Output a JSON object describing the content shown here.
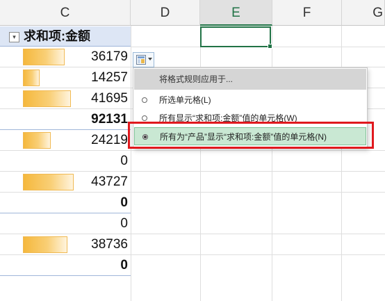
{
  "columns": [
    "C",
    "D",
    "E",
    "F",
    "G"
  ],
  "active_column": "E",
  "pivot_field_label": "求和项:金额",
  "rows": [
    {
      "value": "36179",
      "bold": false,
      "bar": 0.393
    },
    {
      "value": "14257",
      "bold": false,
      "bar": 0.155
    },
    {
      "value": "41695",
      "bold": false,
      "bar": 0.453
    },
    {
      "value": "92131",
      "bold": true,
      "bar": 0
    },
    {
      "value": "24219",
      "bold": false,
      "bar": 0.263
    },
    {
      "value": "0",
      "bold": false,
      "bar": 0
    },
    {
      "value": "43727",
      "bold": false,
      "bar": 0.475
    },
    {
      "value": "0",
      "bold": true,
      "bar": 0
    },
    {
      "value": "0",
      "bold": false,
      "bar": 0
    },
    {
      "value": "38736",
      "bold": false,
      "bar": 0.42
    },
    {
      "value": "0",
      "bold": true,
      "bar": 0
    }
  ],
  "menu": {
    "title": "将格式规则应用于...",
    "options": [
      {
        "label": "所选单元格(L)",
        "selected": false
      },
      {
        "label": "所有显示“求和项:金额”值的单元格(W)",
        "selected": false
      },
      {
        "label": "所有为“产品”显示“求和项:金额”值的单元格(N)",
        "selected": true
      }
    ]
  },
  "colors": {
    "accent_green": "#217346",
    "databar": "#f5b83d",
    "pivot_header_bg": "#dde6f5",
    "highlight_red": "#e0191e"
  }
}
